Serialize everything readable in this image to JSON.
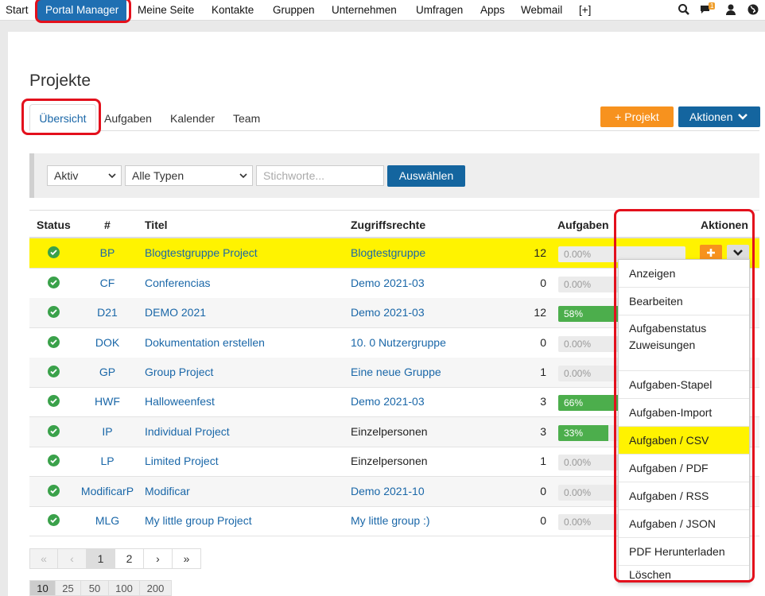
{
  "topnav": {
    "items": [
      "Start",
      "Portal Manager",
      "Meine Seite",
      "Kontakte",
      "Gruppen",
      "Unternehmen",
      "Umfragen",
      "Apps",
      "Webmail",
      "[+]"
    ],
    "notification_count": "1"
  },
  "page": {
    "title": "Projekte"
  },
  "tabs": [
    "Übersicht",
    "Aufgaben",
    "Kalender",
    "Team"
  ],
  "buttons": {
    "new_project": "+ Projekt",
    "actions": "Aktionen"
  },
  "filters": {
    "status": "Aktiv",
    "type": "Alle Typen",
    "tags_placeholder": "Stichworte...",
    "submit": "Auswählen"
  },
  "table": {
    "headers": {
      "status": "Status",
      "id": "#",
      "title": "Titel",
      "access": "Zugriffsrechte",
      "tasks": "Aufgaben",
      "actions": "Aktionen"
    },
    "rows": [
      {
        "code": "BP",
        "title": "Blogtestgruppe Project",
        "access": "Blogtestgruppe",
        "access_link": true,
        "count": "12",
        "progress": "0.00%"
      },
      {
        "code": "CF",
        "title": "Conferencias",
        "access": "Demo 2021-03",
        "access_link": true,
        "count": "0",
        "progress": "0.00%"
      },
      {
        "code": "D21",
        "title": "DEMO 2021",
        "access": "Demo 2021-03",
        "access_link": true,
        "count": "12",
        "progress": "58%"
      },
      {
        "code": "DOK",
        "title": "Dokumentation erstellen",
        "access": "10. 0 Nutzergruppe",
        "access_link": true,
        "count": "0",
        "progress": "0.00%"
      },
      {
        "code": "GP",
        "title": "Group Project",
        "access": "Eine neue Gruppe",
        "access_link": true,
        "count": "1",
        "progress": "0.00%"
      },
      {
        "code": "HWF",
        "title": "Halloweenfest",
        "access": "Demo 2021-03",
        "access_link": true,
        "count": "3",
        "progress": "66%"
      },
      {
        "code": "IP",
        "title": "Individual Project",
        "access": "Einzelpersonen",
        "access_link": false,
        "count": "3",
        "progress": "33%"
      },
      {
        "code": "LP",
        "title": "Limited Project",
        "access": "Einzelpersonen",
        "access_link": false,
        "count": "1",
        "progress": "0.00%"
      },
      {
        "code": "ModificarP",
        "title": "Modificar",
        "access": "Demo 2021-10",
        "access_link": true,
        "count": "0",
        "progress": "0.00%"
      },
      {
        "code": "MLG",
        "title": "My little group Project",
        "access": "My little group :)",
        "access_link": true,
        "count": "0",
        "progress": "0.00%"
      }
    ]
  },
  "dropdown": {
    "items": [
      "Anzeigen",
      "Bearbeiten",
      "Aufgabenstatus Zuweisungen",
      "Aufgaben-Stapel",
      "Aufgaben-Import",
      "Aufgaben / CSV",
      "Aufgaben / PDF",
      "Aufgaben / RSS",
      "Aufgaben / JSON",
      "PDF Herunterladen",
      "Löschen"
    ],
    "highlighted": "Aufgaben / CSV"
  },
  "pagination": {
    "first": "«",
    "prev": "‹",
    "pages": [
      "1",
      "2"
    ],
    "next": "›",
    "last": "»"
  },
  "page_sizes": [
    "10",
    "25",
    "50",
    "100",
    "200"
  ],
  "colors": {
    "brand_blue": "#14659f",
    "accent_orange": "#f7921e",
    "highlight_yellow": "#fff300",
    "annotation_red": "#e3101c",
    "progress_green": "#4cae4c"
  }
}
